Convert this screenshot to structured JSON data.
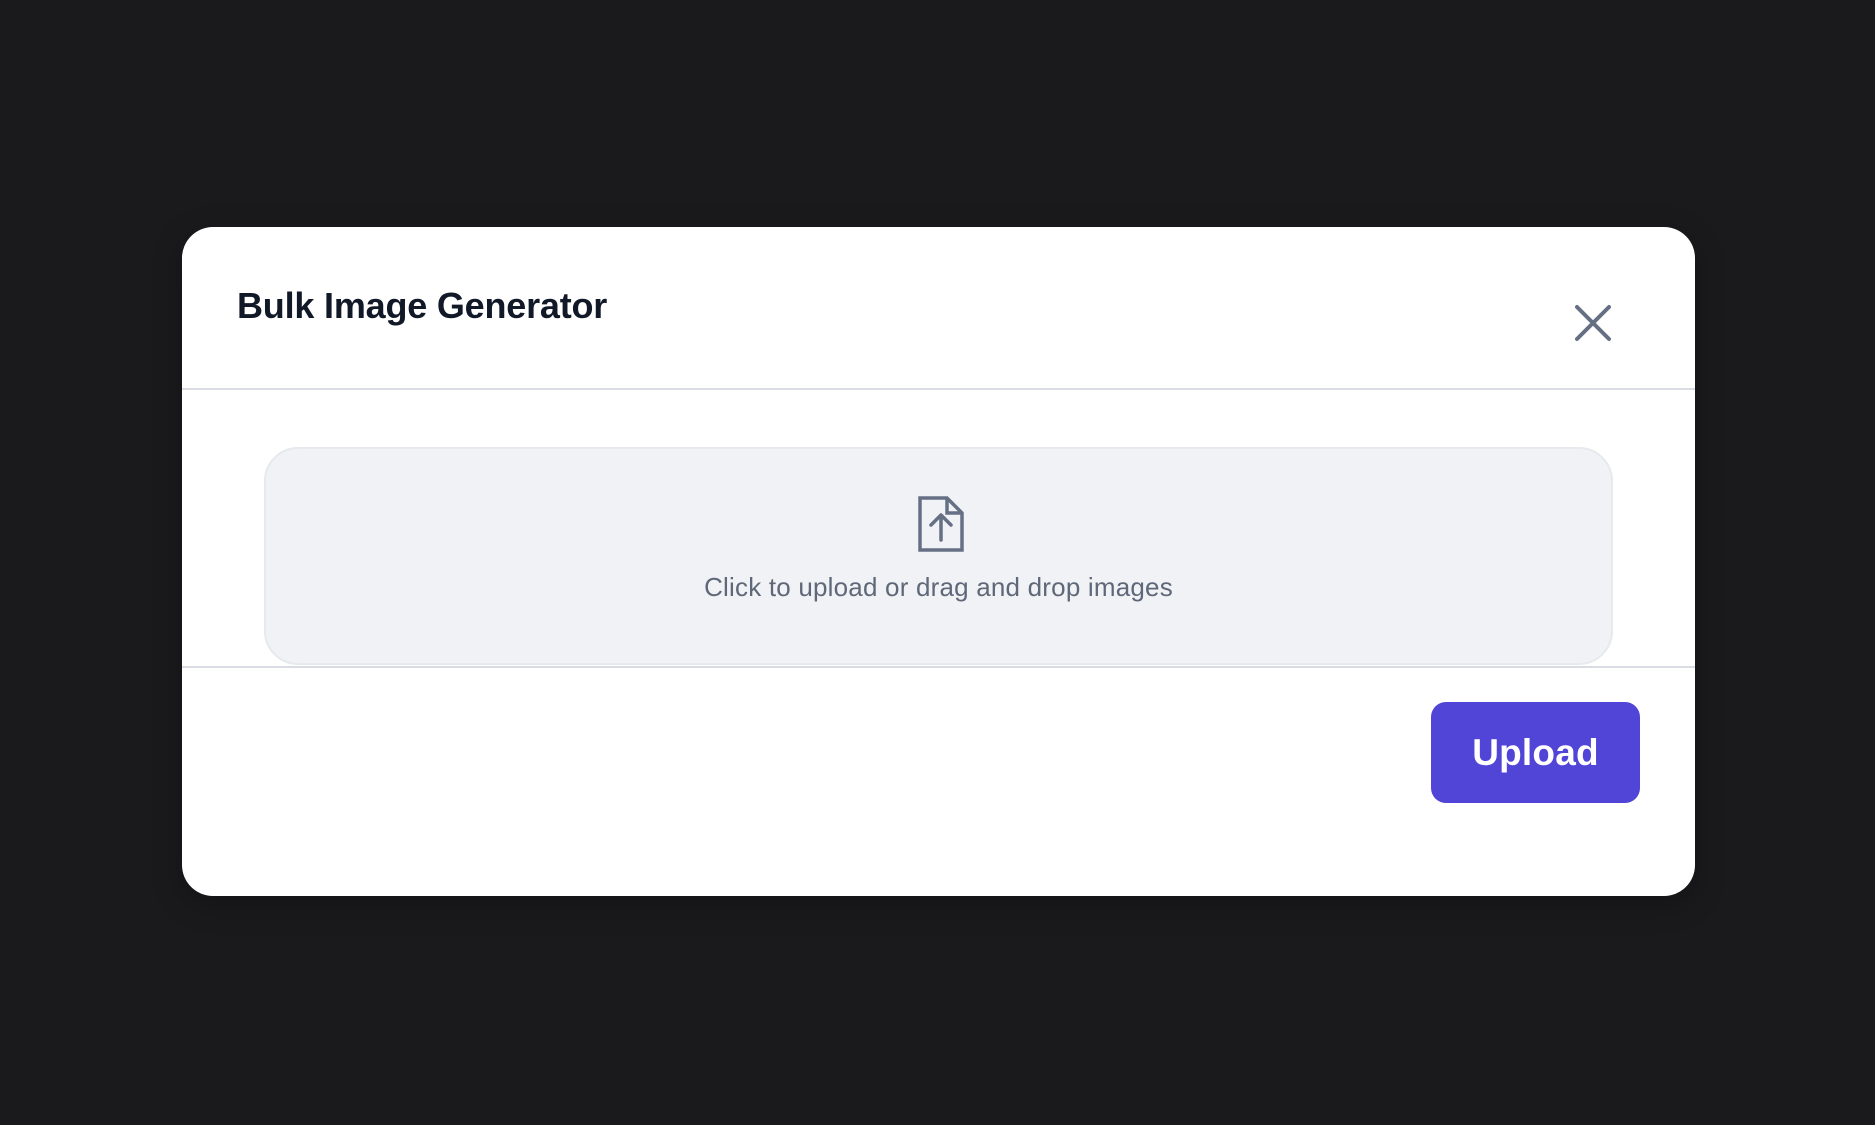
{
  "modal": {
    "title": "Bulk Image Generator",
    "close_icon": "close-icon"
  },
  "dropzone": {
    "icon": "file-upload-icon",
    "text": "Click to upload or drag and drop images"
  },
  "footer": {
    "upload_label": "Upload"
  },
  "colors": {
    "backdrop": "#1a1a1d",
    "accent": "#5145d8",
    "title": "#111827",
    "muted_text": "#5f6878",
    "dropzone_bg": "#f0f2f5"
  }
}
